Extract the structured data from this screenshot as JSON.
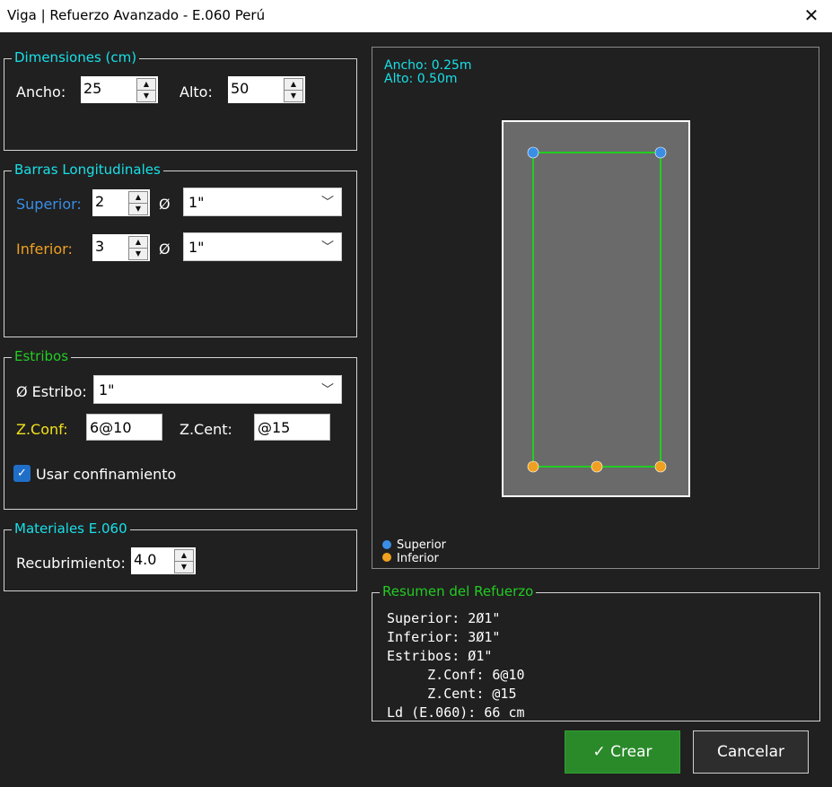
{
  "window": {
    "title": "Viga | Refuerzo Avanzado - E.060 Perú",
    "close_glyph": "✕"
  },
  "dimensiones": {
    "legend": "Dimensiones (cm)",
    "ancho_label": "Ancho:",
    "ancho_value": "25",
    "alto_label": "Alto:",
    "alto_value": "50"
  },
  "barras": {
    "legend": "Barras Longitudinales",
    "superior_label": "Superior:",
    "superior_count": "2",
    "superior_diam": "1\"",
    "inferior_label": "Inferior:",
    "inferior_count": "3",
    "inferior_diam": "1\"",
    "diam_symbol": "Ø"
  },
  "estribos": {
    "legend": "Estribos",
    "diam_label": "Ø Estribo:",
    "diam_value": "1\"",
    "zconf_label": "Z.Conf:",
    "zconf_value": "6@10",
    "zcent_label": "Z.Cent:",
    "zcent_value": "@15",
    "confinamiento_label": "Usar confinamiento",
    "confinamiento_checked": true
  },
  "materiales": {
    "legend": "Materiales E.060",
    "recubrimiento_label": "Recubrimiento:",
    "recubrimiento_value": "4.0"
  },
  "preview": {
    "ancho_text": "Ancho: 0.25m",
    "alto_text": "Alto: 0.50m",
    "legend_superior": "Superior",
    "legend_inferior": "Inferior",
    "superior_bars": 2,
    "inferior_bars": 3
  },
  "resumen": {
    "legend": "Resumen del Refuerzo",
    "lines": [
      "Superior: 2Ø1\"",
      "Inferior: 3Ø1\"",
      "Estribos: Ø1\"",
      "     Z.Conf: 6@10",
      "     Z.Cent: @15",
      "Ld (E.060): 66 cm"
    ]
  },
  "buttons": {
    "crear": "Crear",
    "crear_icon": "✓",
    "cancelar": "Cancelar"
  },
  "colors": {
    "cyan": "#18e0e8",
    "blue": "#3a8ee6",
    "orange": "#f0a020",
    "yellow": "#f2e21b",
    "green": "#22cc22",
    "crear_bg": "#2a8a2a"
  }
}
